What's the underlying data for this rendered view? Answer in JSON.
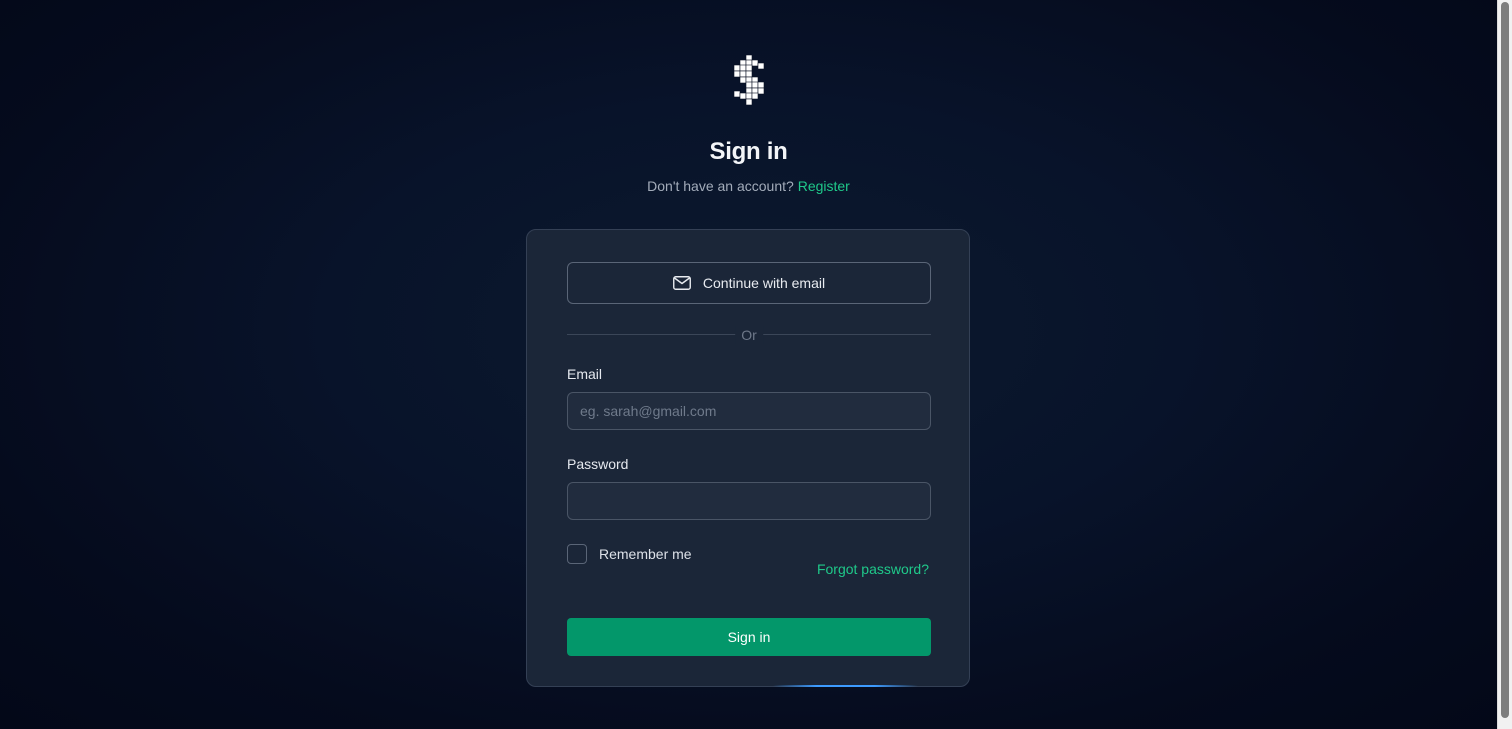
{
  "brand": {
    "logo_icon": "pixel-dollar-sign-icon"
  },
  "header": {
    "title": "Sign in",
    "subtitle_prefix": "Don't have an account?",
    "register_link": "Register"
  },
  "form": {
    "oauth_email_label": "Continue with email",
    "oauth_email_icon": "envelope-icon",
    "divider_text": "Or",
    "email_label": "Email",
    "email_placeholder": "eg. sarah@gmail.com",
    "email_value": "",
    "password_label": "Password",
    "password_value": "",
    "remember_label": "Remember me",
    "remember_checked": false,
    "forgot_link": "Forgot password?",
    "submit_label": "Sign in"
  },
  "colors": {
    "accent": "#1fc98a",
    "primary_button": "#03976a",
    "card_bg": "#1b2638",
    "page_bg": "#050b1d"
  }
}
